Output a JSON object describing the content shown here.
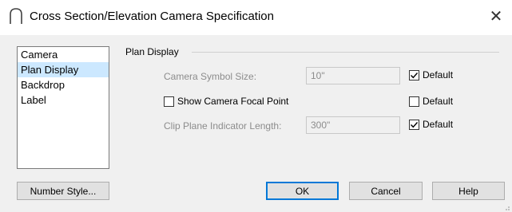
{
  "window": {
    "title": "Cross Section/Elevation Camera Specification",
    "close_symbol": "✕",
    "title_icon": "camera-arc-icon"
  },
  "nav": {
    "items": [
      {
        "label": "Camera",
        "selected": false
      },
      {
        "label": "Plan Display",
        "selected": true
      },
      {
        "label": "Backdrop",
        "selected": false
      },
      {
        "label": "Label",
        "selected": false
      }
    ]
  },
  "plan_display": {
    "group_label": "Plan Display",
    "camera_symbol_size": {
      "label": "Camera Symbol Size:",
      "value": "10\"",
      "default_label": "Default",
      "default_checked": true
    },
    "show_focal_point": {
      "label": "Show Camera Focal Point",
      "checked": false,
      "default_label": "Default",
      "default_checked": false
    },
    "clip_plane_length": {
      "label": "Clip Plane Indicator Length:",
      "value": "300\"",
      "default_label": "Default",
      "default_checked": true
    }
  },
  "buttons": {
    "number_style": "Number Style...",
    "ok": "OK",
    "cancel": "Cancel",
    "help": "Help"
  },
  "colors": {
    "selection": "#cce8ff",
    "accent": "#0078d7",
    "disabled_text": "#8c8c8c"
  }
}
